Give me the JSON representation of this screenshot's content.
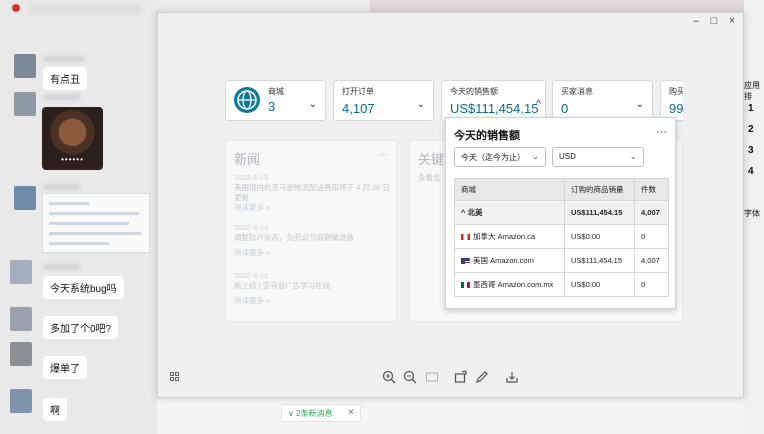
{
  "chat": {
    "messages": [
      "有点丑",
      "今天系统bug吗",
      "多加了个0吧?",
      "爆单了",
      "啊"
    ],
    "image_dots": "••••••",
    "new_messages": "2条新消息"
  },
  "viewer": {
    "controls": {
      "minimize": "–",
      "maximize": "□",
      "close": "×"
    }
  },
  "dashboard": {
    "cards": [
      {
        "label": "商城",
        "value": "3"
      },
      {
        "label": "打开订单",
        "value": "4,107"
      },
      {
        "label": "今天的销售额",
        "value": "US$111,454.15"
      },
      {
        "label": "买家消息",
        "value": "0"
      },
      {
        "label": "购买",
        "value": "99"
      }
    ],
    "news": {
      "title": "新闻",
      "items": [
        {
          "date": "2022-4-13",
          "text": "美国境内的亚马逊物流配送费用将于 4 月 28 日更新",
          "more": "阅读更多 »"
        },
        {
          "date": "2022-4-13",
          "text": "调整账户状态，为劳动节假期做准备",
          "more": "阅读更多 »"
        },
        {
          "date": "2022-4-12",
          "text": "新上线 | 亚马逊广告学习在线",
          "more": "阅读更多 »"
        }
      ]
    },
    "keywords_panel": {
      "title": "关键",
      "sub": "查看您"
    },
    "sales_popup": {
      "title": "今天的销售额",
      "period": "今天（迄今为止）",
      "currency": "USD",
      "headers": [
        "商城",
        "订购的商品销量",
        "件数"
      ],
      "rows": [
        {
          "name": "北美",
          "sales": "US$111,454.15",
          "units": "4,007",
          "region": true,
          "prefix": "^"
        },
        {
          "name": "加拿大 Amazon.ca",
          "sales": "US$0.00",
          "units": "0",
          "flag": "ca"
        },
        {
          "name": "美国 Amazon.com",
          "sales": "US$111,454.15",
          "units": "4,007",
          "flag": "us"
        },
        {
          "name": "墨西哥 Amazon.com.mx",
          "sales": "US$0.00",
          "units": "0",
          "flag": "mx"
        }
      ]
    }
  },
  "side_right": {
    "app_label": "应用排",
    "numbers": [
      "1",
      "2",
      "3",
      "4"
    ],
    "font_label": "字体"
  },
  "colors": {
    "accent": "#0a6e8a",
    "globe": "#0f7a99",
    "newmsg_green": "#2aa84c"
  }
}
